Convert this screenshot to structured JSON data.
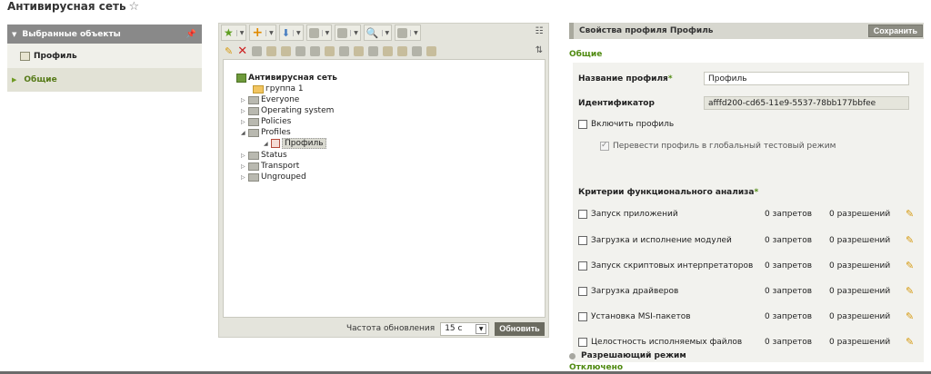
{
  "page": {
    "title": "Антивирусная сеть",
    "favorite_icon": "star-outline-icon"
  },
  "left_panel": {
    "header": "Выбранные объекты",
    "items": [
      {
        "label": "Профиль",
        "icon": "profile-icon"
      },
      {
        "label": "Общие",
        "icon": "triangle-right-icon"
      }
    ]
  },
  "tree": {
    "root": "Антивирусная сеть",
    "nodes": [
      {
        "label": "группа 1"
      },
      {
        "label": "Everyone"
      },
      {
        "label": "Operating system"
      },
      {
        "label": "Policies"
      },
      {
        "label": "Profiles"
      },
      {
        "label": "Профиль"
      },
      {
        "label": "Status"
      },
      {
        "label": "Transport"
      },
      {
        "label": "Ungrouped"
      }
    ],
    "refresh_label": "Частота обновления",
    "refresh_value": "15 с",
    "refresh_button": "Обновить"
  },
  "properties": {
    "header": "Свойства профиля Профиль",
    "save_button": "Сохранить",
    "section": "Общие",
    "name_label": "Название профиля",
    "name_value": "Профиль",
    "id_label": "Идентификатор",
    "id_value": "afffd200-cd65-11e9-5537-78bb177bbfee",
    "enable_label": "Включить профиль",
    "test_mode_label": "Перевести профиль в глобальный тестовый режим",
    "criteria_title": "Критерии функционального анализа",
    "criteria": [
      {
        "name": "Запуск приложений",
        "deny": "0 запретов",
        "allow": "0 разрешений"
      },
      {
        "name": "Загрузка и исполнение модулей",
        "deny": "0 запретов",
        "allow": "0 разрешений"
      },
      {
        "name": "Запуск скриптовых интерпретаторов",
        "deny": "0 запретов",
        "allow": "0 разрешений"
      },
      {
        "name": "Загрузка драйверов",
        "deny": "0 запретов",
        "allow": "0 разрешений"
      },
      {
        "name": "Установка MSI-пакетов",
        "deny": "0 запретов",
        "allow": "0 разрешений"
      },
      {
        "name": "Целостность исполняемых файлов",
        "deny": "0 запретов",
        "allow": "0 разрешений"
      }
    ],
    "mode_label": "Разрешающий режим",
    "mode_status": "Отключено"
  },
  "colors": {
    "accent_green": "#4f8a10",
    "header_gray": "#898989",
    "pencil_orange": "#d69a10"
  }
}
